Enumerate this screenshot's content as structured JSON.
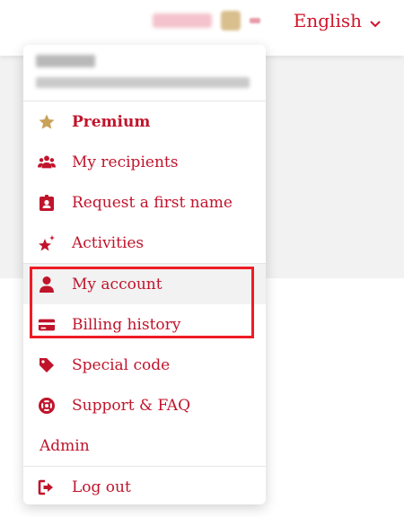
{
  "header": {
    "language_label": "English",
    "language_chevron": "chevron-down-icon"
  },
  "menu": {
    "items": [
      {
        "label": "Premium",
        "icon": "star-icon"
      },
      {
        "label": "My recipients",
        "icon": "users-icon"
      },
      {
        "label": "Request a first name",
        "icon": "badge-icon"
      },
      {
        "label": "Activities",
        "icon": "sparkle-star-icon"
      },
      {
        "label": "My account",
        "icon": "user-icon"
      },
      {
        "label": "Billing history",
        "icon": "credit-card-icon"
      },
      {
        "label": "Special code",
        "icon": "tag-icon"
      },
      {
        "label": "Support & FAQ",
        "icon": "lifebuoy-icon"
      },
      {
        "label": "Admin"
      },
      {
        "label": "Log out",
        "icon": "logout-icon"
      }
    ]
  },
  "colors": {
    "accent": "#c0142b",
    "premium_star": "#c9a25a",
    "highlight_border": "#ee1c25"
  }
}
